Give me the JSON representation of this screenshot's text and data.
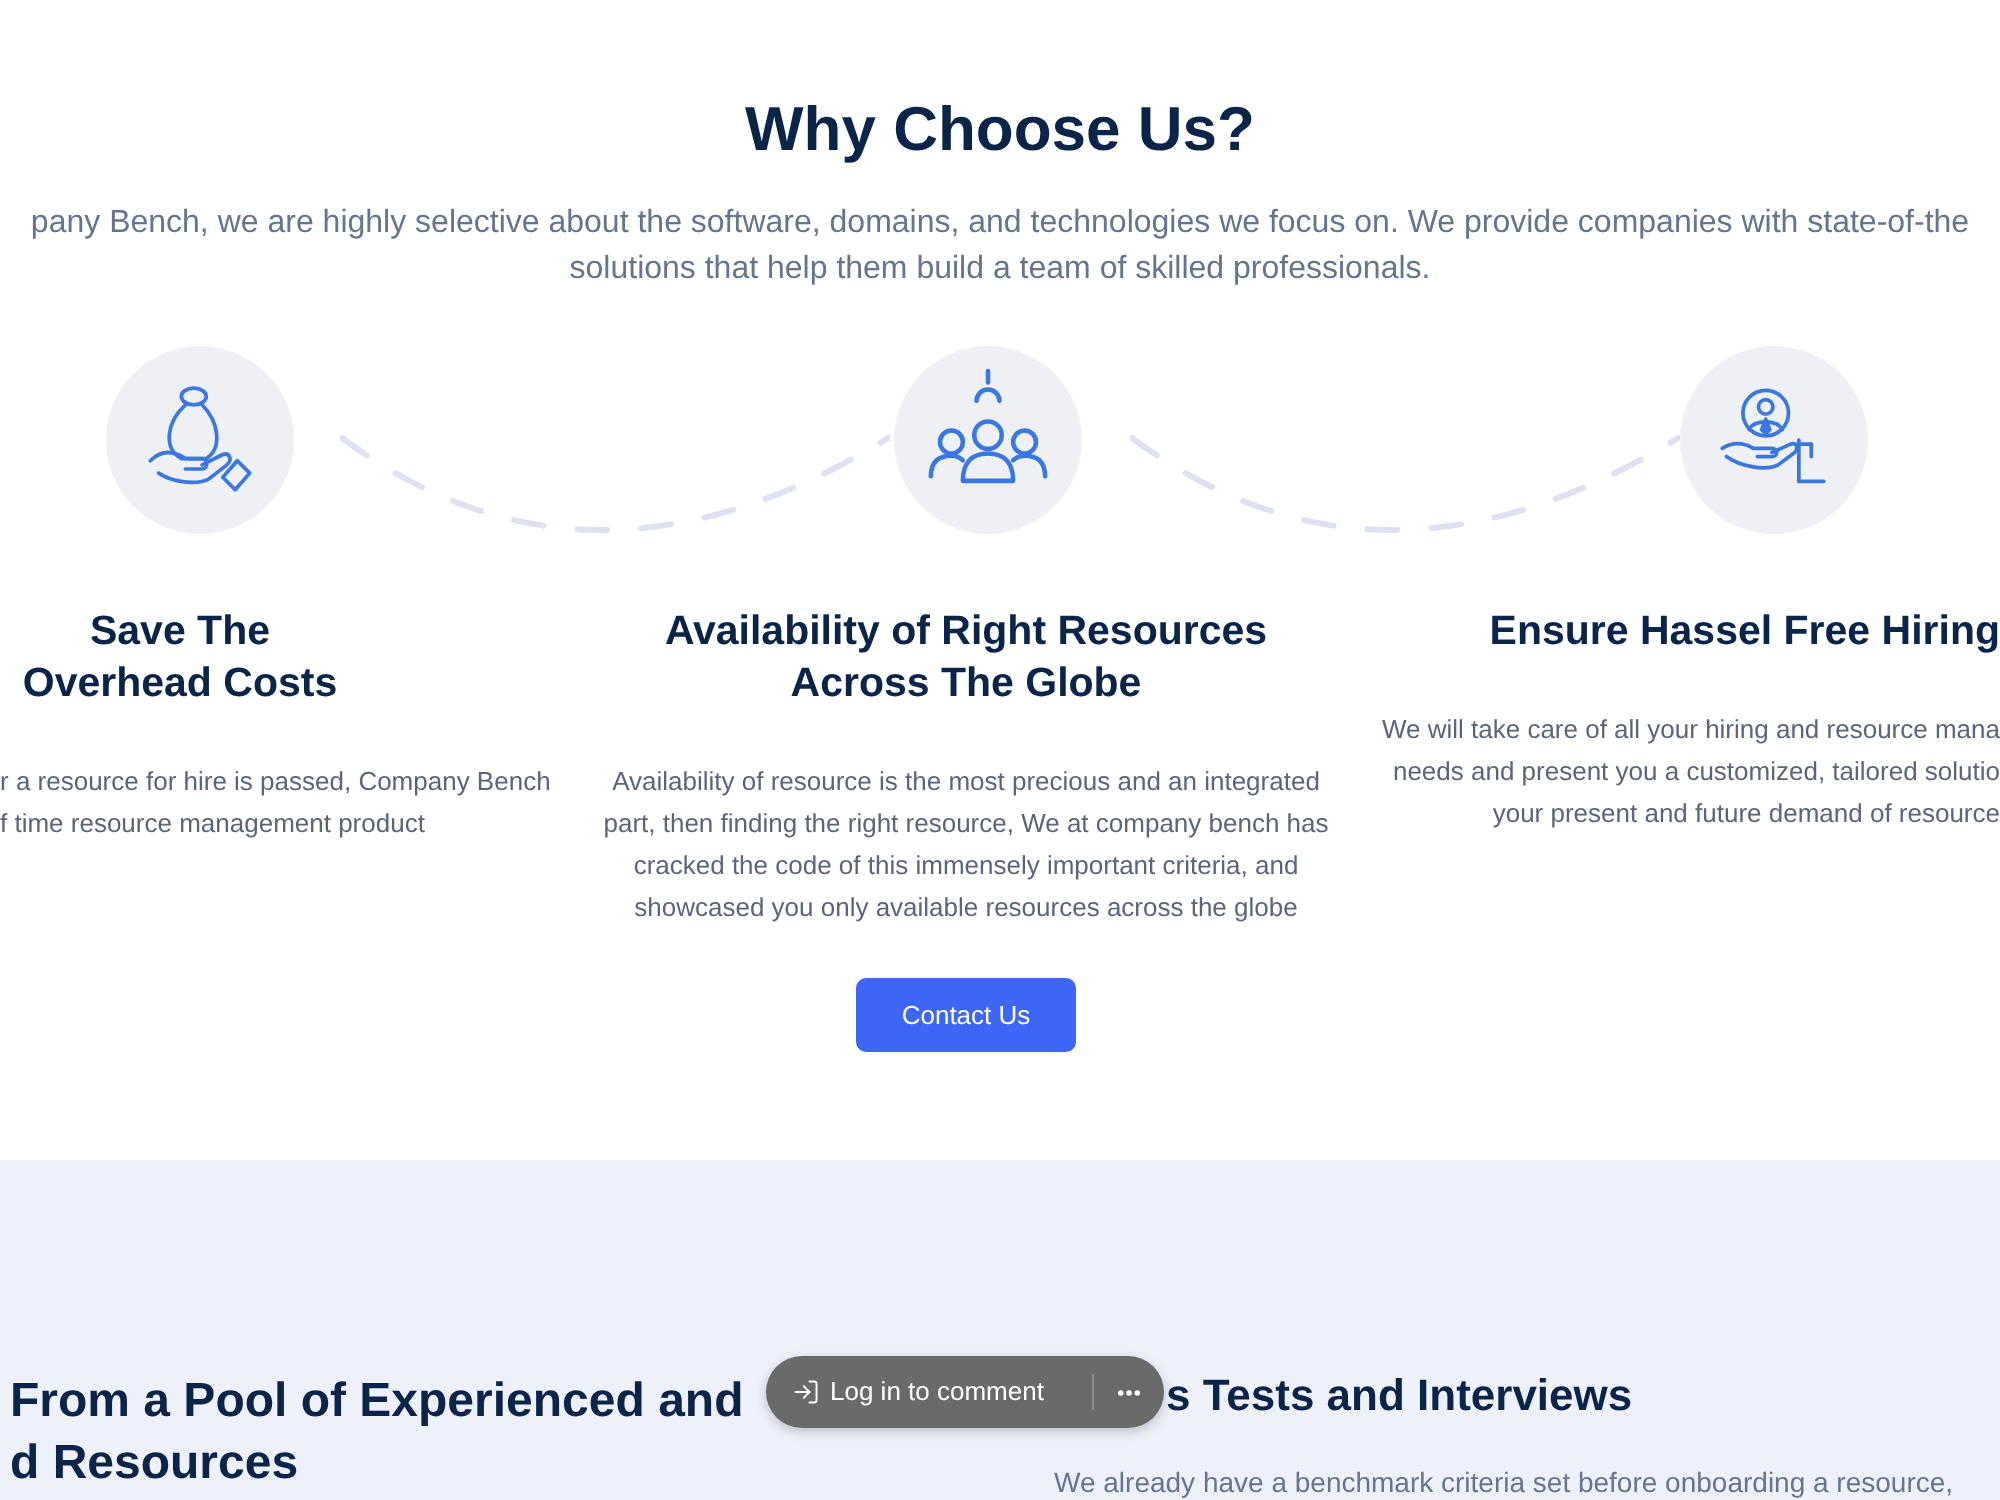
{
  "why_choose_us": {
    "title": "Why Choose Us?",
    "intro_lines": [
      "pany Bench, we are highly selective about the software, domains, and technologies we focus on. We provide companies with state-of-the",
      "solutions that help them build a team of skilled professionals."
    ]
  },
  "features": [
    {
      "title_lines": [
        "Save The",
        "Overhead Costs"
      ],
      "description_lines": [
        "r a resource for hire is passed, Company Bench",
        "f time resource management product"
      ]
    },
    {
      "title_lines": [
        "Availability of Right Resources",
        "Across The Globe"
      ],
      "description_lines": [
        "Availability of resource is the most precious and an integrated",
        "part, then finding the right resource, We at company bench has",
        "cracked the code of this immensely important criteria, and",
        "showcased you only available resources across the globe"
      ]
    },
    {
      "title_lines": [
        "Ensure Hassel Free Hiring"
      ],
      "description_lines": [
        "We will take care of all your hiring and resource mana",
        "needs and present you a customized, tailored solutio",
        "your present and future demand of resource"
      ]
    }
  ],
  "contact_button": {
    "label": "Contact Us"
  },
  "next_section": {
    "left_heading_lines": [
      "From a Pool of Experienced and",
      "d Resources"
    ],
    "right_heading": "s Tests and Interviews",
    "right_text": "We already have a benchmark criteria set before onboarding a resource,"
  },
  "comment_bar": {
    "label": "Log in to comment"
  }
}
